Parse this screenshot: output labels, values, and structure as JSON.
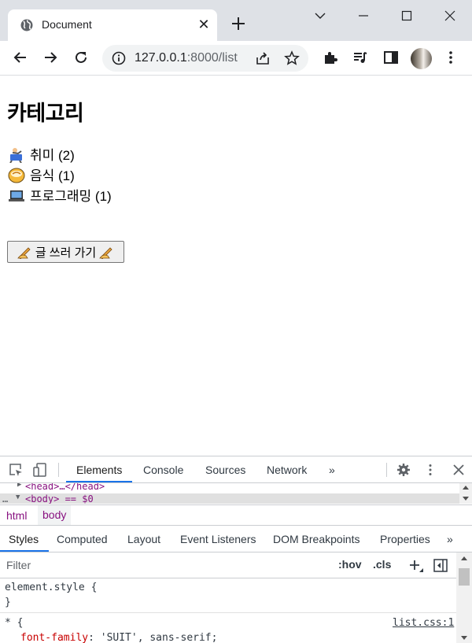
{
  "browser": {
    "tab_title": "Document",
    "url_host": "127.0.0.1",
    "url_path": ":8000/list"
  },
  "page": {
    "heading": "카테고리",
    "categories": [
      {
        "label": "취미 (2)",
        "icon": "person-playing-icon"
      },
      {
        "label": "음식 (1)",
        "icon": "food-bowl-icon"
      },
      {
        "label": "프로그래밍 (1)",
        "icon": "laptop-icon"
      }
    ],
    "write_button": {
      "label": "글 쓰러 가기",
      "icon": "writing-hand-icon"
    }
  },
  "devtools": {
    "tabs": [
      "Elements",
      "Console",
      "Sources",
      "Network"
    ],
    "more_tabs": "»",
    "elements_row1": "<head>…</head>",
    "elements_row2": "<body> == $0",
    "breadcrumbs": [
      "html",
      "body"
    ],
    "sub_tabs": [
      "Styles",
      "Computed",
      "Layout",
      "Event Listeners",
      "DOM Breakpoints",
      "Properties"
    ],
    "filter_placeholder": "Filter",
    "hov_label": ":hov",
    "cls_label": ".cls",
    "rule1_selector": "element.style {",
    "rule1_close": "}",
    "rule2_selector": "* {",
    "rule2_source": "list.css:1",
    "rule2_prop": "font-family",
    "rule2_value": ": 'SUIT', sans-serif;"
  }
}
